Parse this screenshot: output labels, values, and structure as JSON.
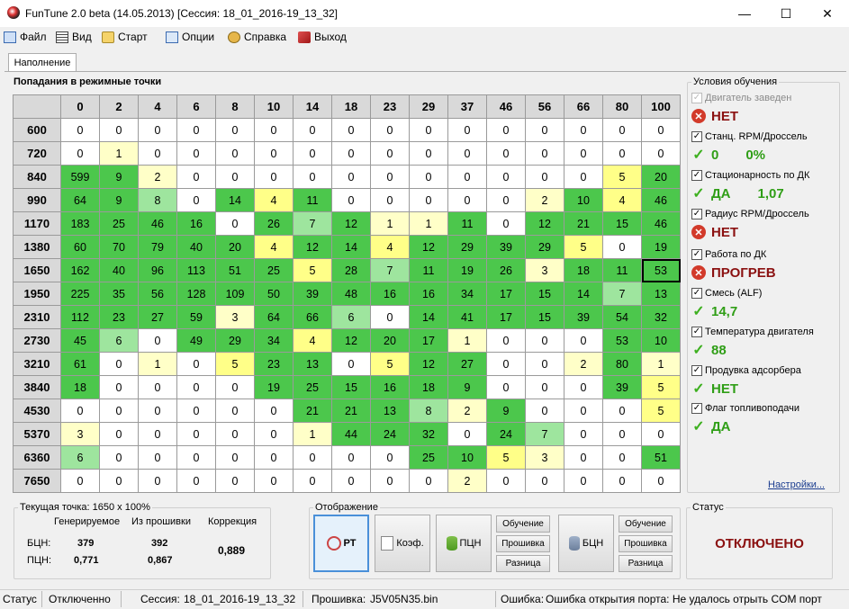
{
  "window": {
    "title": "FunTune 2.0 beta (14.05.2013) [Сессия: 18_01_2016-19_13_32]",
    "minimize": "—",
    "maximize": "☐",
    "close": "✕"
  },
  "menu": [
    {
      "label": "Файл",
      "icon": "file-icon"
    },
    {
      "label": "Вид",
      "icon": "view-icon"
    },
    {
      "label": "Старт",
      "icon": "start-icon"
    },
    {
      "label": "Опции",
      "icon": "options-icon"
    },
    {
      "label": "Справка",
      "icon": "help-icon"
    },
    {
      "label": "Выход",
      "icon": "exit-icon"
    }
  ],
  "tabs": [
    {
      "label": "Наполнение",
      "active": true
    }
  ],
  "grid": {
    "title": "Попадания в режимные точки",
    "columns": [
      "0",
      "2",
      "4",
      "6",
      "8",
      "10",
      "14",
      "18",
      "23",
      "29",
      "37",
      "46",
      "56",
      "66",
      "80",
      "100"
    ],
    "rows": [
      "600",
      "720",
      "840",
      "990",
      "1170",
      "1380",
      "1650",
      "1950",
      "2310",
      "2730",
      "3210",
      "3840",
      "4530",
      "5370",
      "6360",
      "7650"
    ],
    "values": [
      [
        0,
        0,
        0,
        0,
        0,
        0,
        0,
        0,
        0,
        0,
        0,
        0,
        0,
        0,
        0,
        0
      ],
      [
        0,
        1,
        0,
        0,
        0,
        0,
        0,
        0,
        0,
        0,
        0,
        0,
        0,
        0,
        0,
        0
      ],
      [
        599,
        9,
        2,
        0,
        0,
        0,
        0,
        0,
        0,
        0,
        0,
        0,
        0,
        0,
        5,
        20
      ],
      [
        64,
        9,
        8,
        0,
        14,
        4,
        11,
        0,
        0,
        0,
        0,
        0,
        2,
        10,
        4,
        46
      ],
      [
        183,
        25,
        46,
        16,
        0,
        26,
        7,
        12,
        1,
        1,
        11,
        0,
        12,
        21,
        15,
        46
      ],
      [
        60,
        70,
        79,
        40,
        20,
        4,
        12,
        14,
        4,
        12,
        29,
        39,
        29,
        5,
        0,
        19
      ],
      [
        162,
        40,
        96,
        113,
        51,
        25,
        5,
        28,
        7,
        11,
        19,
        26,
        3,
        18,
        11,
        53
      ],
      [
        225,
        35,
        56,
        128,
        109,
        50,
        39,
        48,
        16,
        16,
        34,
        17,
        15,
        14,
        7,
        13
      ],
      [
        112,
        23,
        27,
        59,
        3,
        64,
        66,
        6,
        0,
        14,
        41,
        17,
        15,
        39,
        54,
        32
      ],
      [
        45,
        6,
        0,
        49,
        29,
        34,
        4,
        12,
        20,
        17,
        1,
        0,
        0,
        0,
        53,
        10
      ],
      [
        61,
        0,
        1,
        0,
        5,
        23,
        13,
        0,
        5,
        12,
        27,
        0,
        0,
        2,
        80,
        1
      ],
      [
        18,
        0,
        0,
        0,
        0,
        19,
        25,
        15,
        16,
        18,
        9,
        0,
        0,
        0,
        39,
        5
      ],
      [
        0,
        0,
        0,
        0,
        0,
        0,
        21,
        21,
        13,
        8,
        2,
        9,
        0,
        0,
        0,
        5
      ],
      [
        3,
        0,
        0,
        0,
        0,
        0,
        1,
        44,
        24,
        32,
        0,
        24,
        7,
        0,
        0,
        0
      ],
      [
        6,
        0,
        0,
        0,
        0,
        0,
        0,
        0,
        0,
        25,
        10,
        5,
        3,
        0,
        0,
        51
      ],
      [
        0,
        0,
        0,
        0,
        0,
        0,
        0,
        0,
        0,
        0,
        2,
        0,
        0,
        0,
        0,
        0
      ]
    ],
    "current_cell": {
      "row": "1650",
      "col": "100"
    },
    "colors": {
      "header": "#d9d9d9",
      "zero": "#ffffff",
      "low": "#ffffc8",
      "mid": "#ffff88",
      "midgreen": "#9ee59e",
      "high": "#4cc74c"
    }
  },
  "conditions": {
    "title": "Условия обучения",
    "items": [
      {
        "label": "Двигатель заведен",
        "checked": true,
        "disabled": true,
        "status": "error",
        "value": "НЕТ",
        "value2": ""
      },
      {
        "label": "Станц. RPM/Дроссель",
        "checked": true,
        "disabled": false,
        "status": "ok",
        "value": "0",
        "value2": "0%"
      },
      {
        "label": "Стационарность по ДК",
        "checked": true,
        "disabled": false,
        "status": "ok",
        "value": "ДА",
        "value2": "1,07"
      },
      {
        "label": "Радиус RPM/Дроссель",
        "checked": true,
        "disabled": false,
        "status": "error",
        "value": "НЕТ",
        "value2": ""
      },
      {
        "label": "Работа по ДК",
        "checked": true,
        "disabled": false,
        "status": "error",
        "value": "ПРОГРЕВ",
        "value2": ""
      },
      {
        "label": "Смесь (ALF)",
        "checked": true,
        "disabled": false,
        "status": "ok",
        "value": "14,7",
        "value2": ""
      },
      {
        "label": "Температура двигателя",
        "checked": true,
        "disabled": false,
        "status": "ok",
        "value": "88",
        "value2": ""
      },
      {
        "label": "Продувка адсорбера",
        "checked": true,
        "disabled": false,
        "status": "ok",
        "value": "НЕТ",
        "value2": ""
      },
      {
        "label": "Флаг топливоподачи",
        "checked": true,
        "disabled": false,
        "status": "ok",
        "value": "ДА",
        "value2": ""
      }
    ],
    "settings_link": "Настройки..."
  },
  "current_point": {
    "title": "Текущая точка: 1650 x 100%",
    "col_generated": "Генерируемое",
    "col_firmware": "Из прошивки",
    "col_correction": "Коррекция",
    "row1_label": "БЦН:",
    "row1_generated": "379",
    "row1_firmware": "392",
    "row2_label": "ПЦН:",
    "row2_generated": "0,771",
    "row2_firmware": "0,867",
    "correction": "0,889"
  },
  "display": {
    "title": "Отображение",
    "btn_rt": "РТ",
    "btn_coef": "Коэф.",
    "btn_pcn": "ПЦН",
    "btn_bcn": "БЦН",
    "sub_learn": "Обучение",
    "sub_firmware": "Прошивка",
    "sub_diff": "Разница"
  },
  "status_panel": {
    "title": "Статус",
    "value": "ОТКЛЮЧЕНО"
  },
  "statusbar": {
    "status_label": "Статус",
    "status_value": "Отключенно",
    "session_label": "Сессия:",
    "session_value": "18_01_2016-19_13_32",
    "firmware_label": "Прошивка:",
    "firmware_value": "J5V05N35.bin",
    "error_label": "Ошибка:",
    "error_value": "Ошибка открытия порта: Не удалось отрыть COM порт"
  }
}
